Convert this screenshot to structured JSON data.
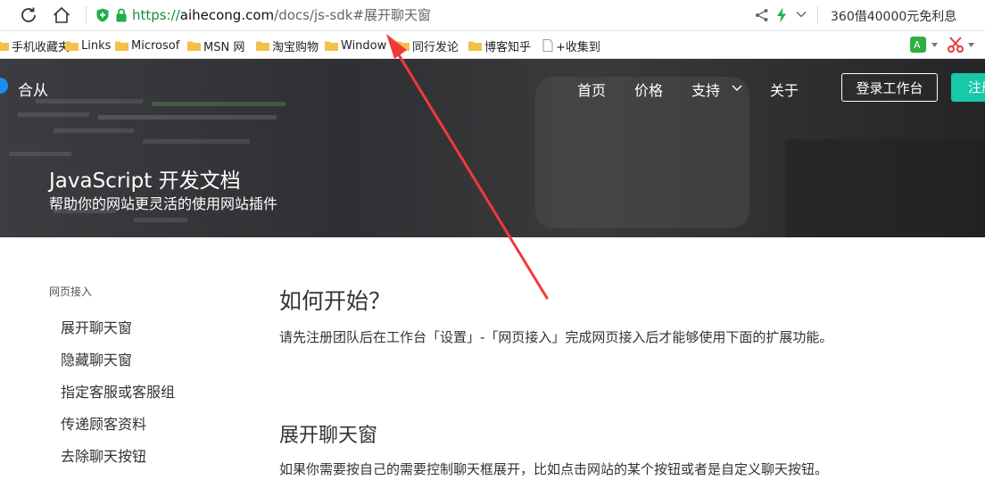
{
  "browser": {
    "url_protocol": "https://",
    "url_host": "aihecong.com",
    "url_path": "/docs/js-sdk#展开聊天窗",
    "search_hint": "360借40000元免利息",
    "icons": [
      "refresh-icon",
      "home-icon",
      "shield-icon",
      "lock-icon",
      "share-icon",
      "bolt-icon",
      "chevron-down-icon"
    ]
  },
  "bookmarks": [
    {
      "label": "手机收藏夹",
      "icon": "folder-icon"
    },
    {
      "label": "Links",
      "icon": "folder-icon"
    },
    {
      "label": "Microsof",
      "icon": "folder-icon"
    },
    {
      "label": "MSN 网",
      "icon": "folder-icon"
    },
    {
      "label": "淘宝购物",
      "icon": "folder-icon"
    },
    {
      "label": "Window",
      "icon": "folder-icon"
    },
    {
      "label": "同行发论",
      "icon": "folder-icon"
    },
    {
      "label": "博客知乎",
      "icon": "folder-icon"
    },
    {
      "label": "+收集到",
      "icon": "page-icon"
    }
  ],
  "site": {
    "brand": "合从",
    "nav": [
      "首页",
      "价格",
      "支持",
      "关于"
    ],
    "login_button": "登录工作台",
    "register_button": "注册",
    "accent_color": "#18c8a8",
    "hero_title": "JavaScript 开发文档",
    "hero_subtitle": "帮助你的网站更灵活的使用网站插件"
  },
  "sidebar": {
    "group_title": "网页接入",
    "items": [
      "展开聊天窗",
      "隐藏聊天窗",
      "指定客服或客服组",
      "传递顾客资料",
      "去除聊天按钮"
    ]
  },
  "content": {
    "section1_title": "如何开始？",
    "section1_text": "请先注册团队后在工作台「设置」-「网页接入」完成网页接入后才能够使用下面的扩展功能。",
    "section2_title": "展开聊天窗",
    "section2_text": "如果你需要按自己的需要控制聊天框展开，比如点击网站的某个按钮或者是自定义聊天按钮。"
  },
  "annotation": {
    "type": "arrow",
    "color": "#f03a3a"
  }
}
